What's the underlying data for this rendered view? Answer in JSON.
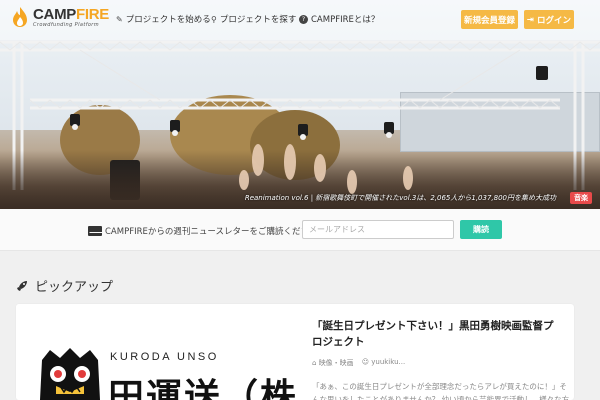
{
  "logo": {
    "title_main": "CAMP",
    "title_accent": "FIRE",
    "subtitle": "Crowdfunding Platform"
  },
  "nav": {
    "start_project": "プロジェクトを始める",
    "find_project": "プロジェクトを探す",
    "about": "CAMPFIREとは？",
    "signup": "新規会員登録",
    "login": "ログイン"
  },
  "hero": {
    "caption": "Reanimation vol.6 | 新宿歌舞伎町で開催されたvol.3は、2,065人から1,037,800円を集め大成功",
    "badge": "音楽"
  },
  "newsletter": {
    "text": "CAMPFIREからの週刊ニュースレターをご購読ください",
    "placeholder": "メールアドレス",
    "button": "購読"
  },
  "pickup": {
    "title": "ピックアップ",
    "card": {
      "image_brand": "KURODA UNSO",
      "image_kanji": "田運送（株",
      "title": "「誕生日プレゼント下さい！」黒田勇樹映画監督プロジェクト",
      "category": "映像・映画",
      "author": "yuukiku...",
      "description": "「あぁ、この誕生日プレゼントが全部理念だったらアレが買えたのに！」そんな思いをしたことがありませんか？ 幼い頃から芸能界で活動し、様々な方から誕"
    }
  },
  "colors": {
    "accent_orange": "#f5b945",
    "accent_teal": "#2fc7a8",
    "badge_red": "#e84a4a"
  }
}
